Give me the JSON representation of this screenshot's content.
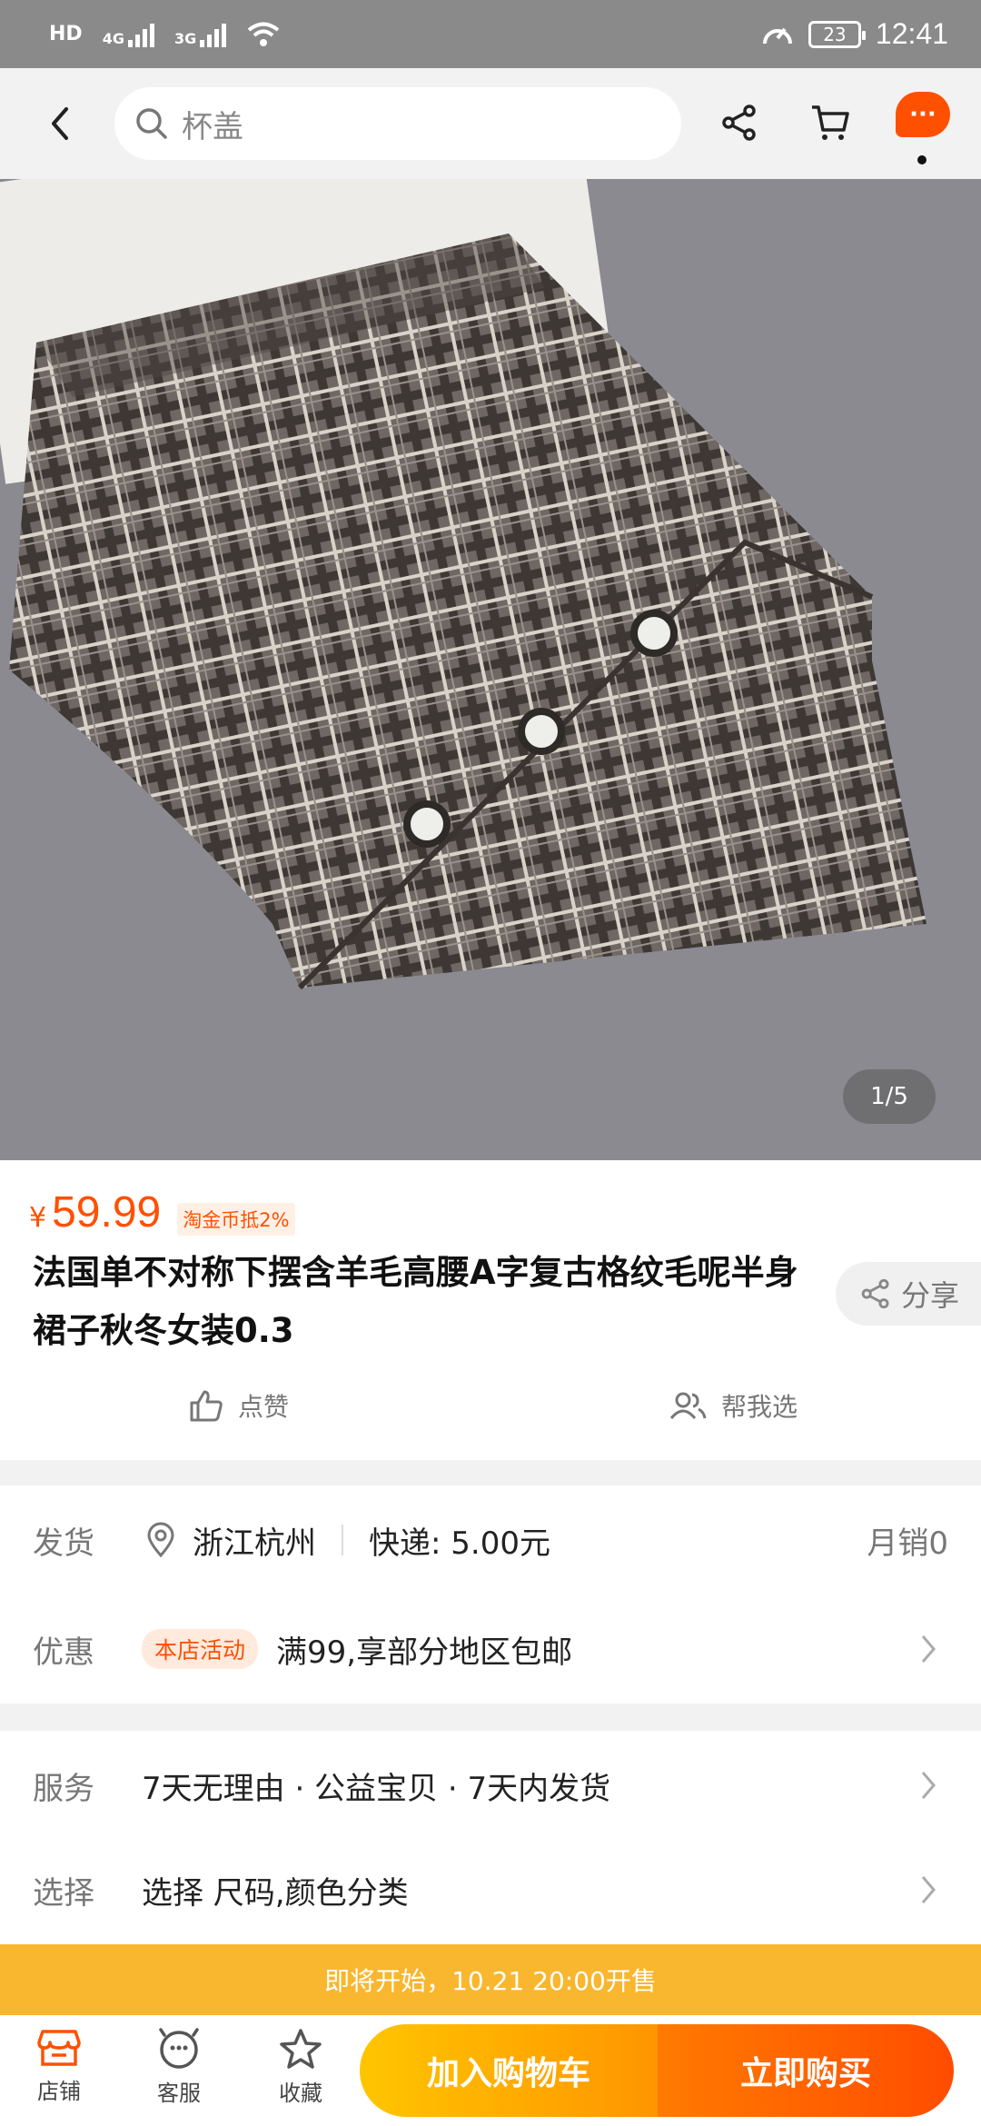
{
  "status_bar": {
    "network_left": "HD",
    "sim1": "4G",
    "sim2": "3G",
    "battery": "23",
    "time": "12:41"
  },
  "header": {
    "search_placeholder": "杯盖",
    "more_label": "···",
    "icons": [
      "back-icon",
      "search-icon",
      "share-icon",
      "cart-icon",
      "more-icon"
    ]
  },
  "gallery": {
    "counter": "1/5"
  },
  "product": {
    "currency": "¥",
    "price": "59.99",
    "coin_badge": "淘金币抵2%",
    "title": "法国单不对称下摆含羊毛高腰A字复古格纹毛呢半身裙子秋冬女装0.3",
    "share_label": "分享",
    "like_label": "点赞",
    "help_choose_label": "帮我选"
  },
  "shipping": {
    "label": "发货",
    "location": "浙江杭州",
    "express": "快递: 5.00元",
    "monthly_sales": "月销0"
  },
  "promotion": {
    "label": "优惠",
    "badge": "本店活动",
    "text": "满99,享部分地区包邮"
  },
  "service": {
    "label": "服务",
    "text": "7天无理由 · 公益宝贝 · 7天内发货"
  },
  "select": {
    "label": "选择",
    "text": "选择 尺码,颜色分类"
  },
  "presale_banner": "即将开始，10.21 20:00开售",
  "bottom_bar": {
    "store_label": "店铺",
    "service_label": "客服",
    "favorite_label": "收藏",
    "add_to_cart": "加入购物车",
    "buy_now": "立即购买"
  },
  "colors": {
    "accent": "#ff5000",
    "cart_gradient_start": "#ffc500",
    "buy_gradient_end": "#ff4c00",
    "banner": "#f9b62f"
  }
}
